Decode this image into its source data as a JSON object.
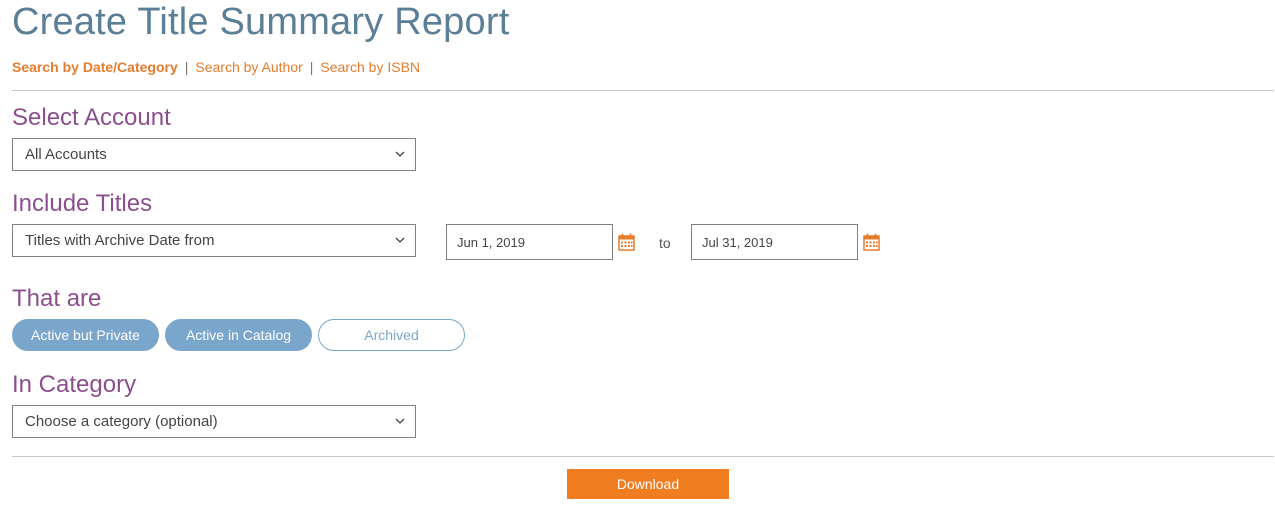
{
  "page": {
    "title": "Create Title Summary Report"
  },
  "tabs": [
    {
      "label": "Search by Date/Category",
      "active": true
    },
    {
      "label": "Search by Author",
      "active": false
    },
    {
      "label": "Search by ISBN",
      "active": false
    }
  ],
  "tab_separator": "|",
  "account": {
    "label": "Select Account",
    "selected": "All Accounts"
  },
  "include_titles": {
    "label": "Include Titles",
    "selected": "Titles with Archive Date from",
    "date_from": "Jun 1, 2019",
    "to_label": "to",
    "date_to": "Jul 31, 2019"
  },
  "status": {
    "label": "That are",
    "options": [
      {
        "label": "Active but Private",
        "selected": true
      },
      {
        "label": "Active in Catalog",
        "selected": true
      },
      {
        "label": "Archived",
        "selected": false
      }
    ]
  },
  "category": {
    "label": "In Category",
    "selected": "Choose a category (optional)"
  },
  "actions": {
    "download_label": "Download"
  },
  "colors": {
    "title": "#5b7f96",
    "tab_link": "#e57c2e",
    "section_label": "#8b4f8e",
    "pill_selected": "#7aa6cc",
    "calendar_icon": "#e57c2e",
    "download_button": "#f07d20"
  },
  "icons": {
    "select_chevron": "chevron-down-icon",
    "date_picker": "calendar-icon"
  }
}
